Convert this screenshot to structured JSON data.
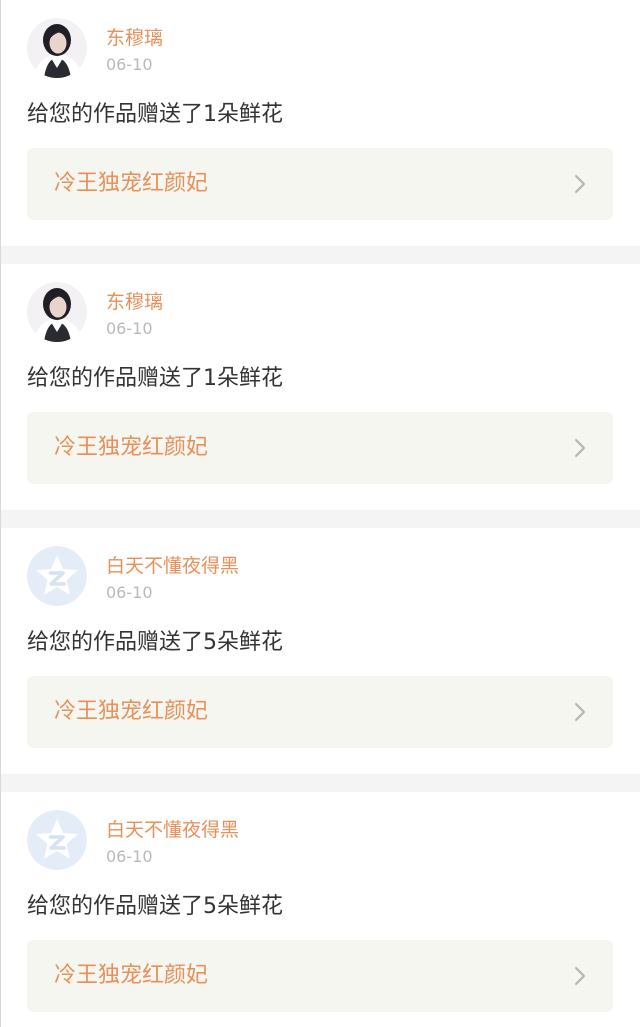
{
  "notifications": [
    {
      "username": "东穆璃",
      "date": "06-10",
      "message": "给您的作品赠送了1朵鲜花",
      "work_title": "冷王独宠红颜妃",
      "avatar": "user-photo-avatar"
    },
    {
      "username": "东穆璃",
      "date": "06-10",
      "message": "给您的作品赠送了1朵鲜花",
      "work_title": "冷王独宠红颜妃",
      "avatar": "user-photo-avatar"
    },
    {
      "username": "白天不懂夜得黑",
      "date": "06-10",
      "message": "给您的作品赠送了5朵鲜花",
      "work_title": "冷王独宠红颜妃",
      "avatar": "qzone-star-icon"
    },
    {
      "username": "白天不懂夜得黑",
      "date": "06-10",
      "message": "给您的作品赠送了5朵鲜花",
      "work_title": "冷王独宠红颜妃",
      "avatar": "qzone-star-icon"
    }
  ],
  "colors": {
    "accent": "#e6915b",
    "muted": "#b9b9b9",
    "text": "#333333",
    "work_box_bg": "#f6f6f0",
    "divider_bg": "#f4f4f4",
    "default_avatar_bg": "#e3ecf7",
    "default_avatar_fg": "#ffffff"
  }
}
